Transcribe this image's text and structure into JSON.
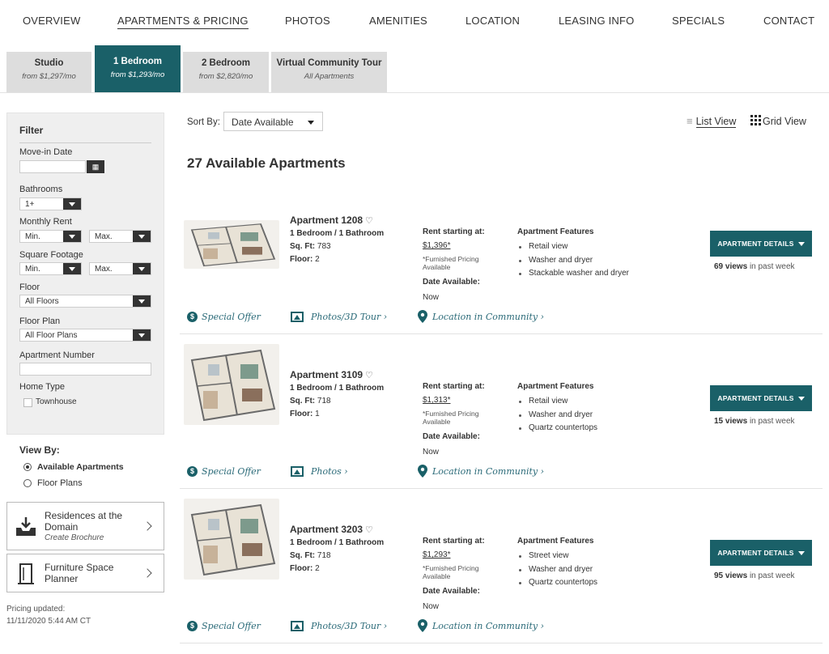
{
  "nav": {
    "items": [
      "OVERVIEW",
      "APARTMENTS & PRICING",
      "PHOTOS",
      "AMENITIES",
      "LOCATION",
      "LEASING INFO",
      "SPECIALS",
      "CONTACT"
    ]
  },
  "tabs": [
    {
      "label": "Studio",
      "sub": "from $1,297/mo"
    },
    {
      "label": "1 Bedroom",
      "sub": "from $1,293/mo"
    },
    {
      "label": "2 Bedroom",
      "sub": "from $2,820/mo"
    },
    {
      "label": "Virtual Community Tour",
      "sub": "All Apartments"
    }
  ],
  "filter": {
    "title": "Filter",
    "move_in_label": "Move-in Date",
    "bathrooms_label": "Bathrooms",
    "bathrooms_value": "1+",
    "rent_label": "Monthly Rent",
    "min": "Min.",
    "max": "Max.",
    "sqft_label": "Square Footage",
    "floor_label": "Floor",
    "floor_value": "All Floors",
    "floorplan_label": "Floor Plan",
    "floorplan_value": "All Floor Plans",
    "aptnum_label": "Apartment Number",
    "hometype_label": "Home Type",
    "townhouse_label": "Townhouse"
  },
  "viewby": {
    "title": "View By:",
    "options": [
      "Available Apartments",
      "Floor Plans"
    ]
  },
  "cards": {
    "brochure_title": "Residences at the Domain",
    "brochure_sub": "Create Brochure",
    "planner_title": "Furniture Space Planner"
  },
  "pricing_updated": {
    "label": "Pricing updated:",
    "value": "11/11/2020 5:44 AM CT"
  },
  "sort": {
    "label": "Sort By:",
    "value": "Date Available"
  },
  "views": {
    "list": "List View",
    "grid": "Grid View"
  },
  "count_text": "27 Available Apartments",
  "labels": {
    "sqft": "Sq. Ft:",
    "floor": "Floor:",
    "rent_heading": "Rent starting at:",
    "furnished": "*Furnished Pricing Available",
    "date_heading": "Date Available:",
    "features_heading": "Apartment Features",
    "details_button": "APARTMENT DETAILS",
    "views_suffix": "in past week",
    "special": "Special Offer",
    "location": "Location in Community ›"
  },
  "apartments": [
    {
      "name": "Apartment 1208",
      "beds": "1 Bedroom / 1 Bathroom",
      "sqft": "783",
      "floor": "2",
      "rent": "$1,396*",
      "date": "Now",
      "features": [
        "Retail view",
        "Washer and dryer",
        "Stackable washer and dryer"
      ],
      "views": "69 views",
      "photos_link": "Photos/3D Tour ›"
    },
    {
      "name": "Apartment 3109",
      "beds": "1 Bedroom / 1 Bathroom",
      "sqft": "718",
      "floor": "1",
      "rent": "$1,313*",
      "date": "Now",
      "features": [
        "Retail view",
        "Washer and dryer",
        "Quartz countertops"
      ],
      "views": "15 views",
      "photos_link": "Photos ›"
    },
    {
      "name": "Apartment 3203",
      "beds": "1 Bedroom / 1 Bathroom",
      "sqft": "718",
      "floor": "2",
      "rent": "$1,293*",
      "date": "Now",
      "features": [
        "Street view",
        "Washer and dryer",
        "Quartz countertops"
      ],
      "views": "95 views",
      "photos_link": "Photos/3D Tour ›"
    }
  ],
  "colors": {
    "accent": "#1a6068",
    "link": "#2a6a78",
    "tab_inactive": "#dddddd",
    "filter_bg": "#efefef"
  }
}
